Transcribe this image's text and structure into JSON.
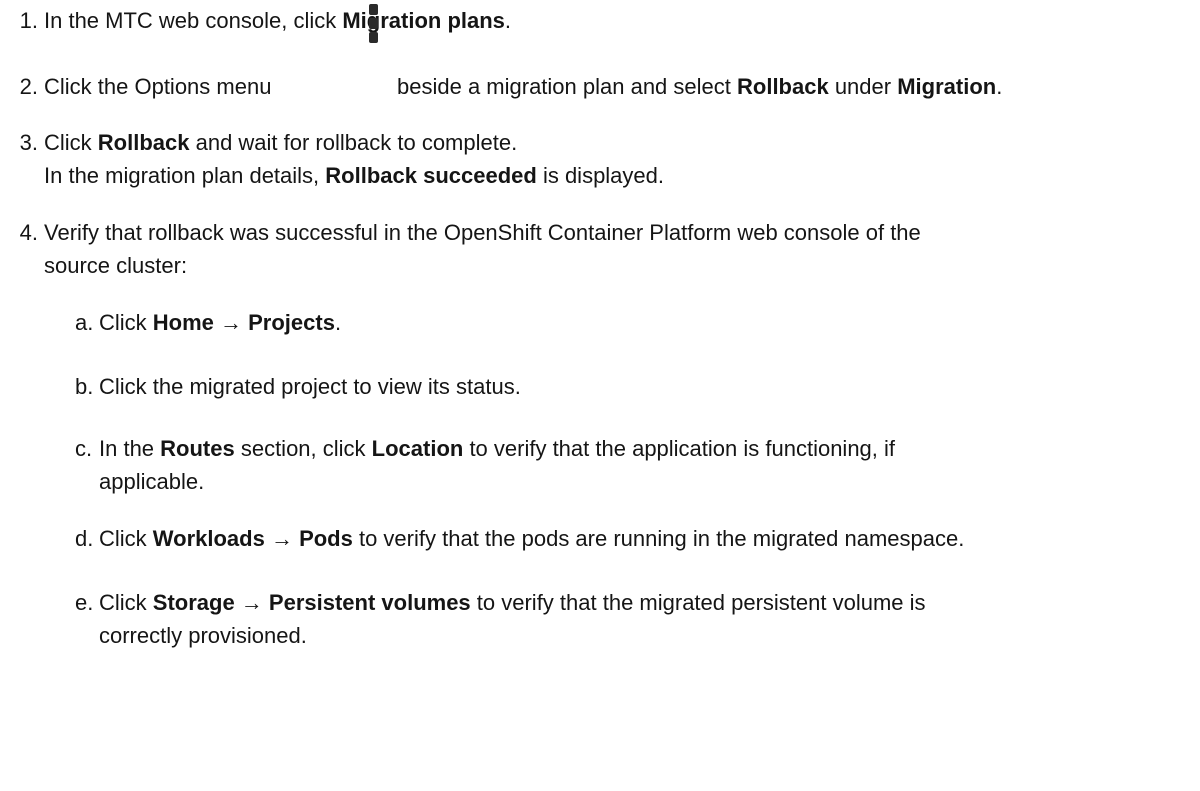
{
  "steps": [
    {
      "number": "1.",
      "parts": [
        "In the MTC web console, click ",
        "Migration plans",
        "."
      ]
    },
    {
      "number": "2.",
      "parts": [
        "Click the Options menu",
        "beside a migration plan and select ",
        "Rollback",
        " under ",
        "Migration",
        "."
      ],
      "icon": "kebab-icon"
    },
    {
      "number": "3.",
      "parts": [
        "Click ",
        "Rollback",
        " and wait for rollback to complete."
      ],
      "note_parts": [
        "In the migration plan details, ",
        "Rollback succeeded",
        " is displayed."
      ]
    },
    {
      "number": "4.",
      "lines": [
        "Verify that rollback was successful in the OpenShift Container Platform web console of the",
        "source cluster:"
      ],
      "substeps": [
        {
          "letter": "a.",
          "parts": [
            "Click ",
            "Home → Projects",
            "."
          ]
        },
        {
          "letter": "b.",
          "parts": [
            "Click the migrated project to view its status."
          ]
        },
        {
          "letter": "c.",
          "parts": [
            "In the ",
            "Routes",
            " section, click ",
            "Location",
            " to verify that the application is functioning, if"
          ],
          "continuation": "applicable."
        },
        {
          "letter": "d.",
          "parts": [
            "Click ",
            "Workloads → Pods",
            " to verify that the pods are running in the migrated namespace."
          ]
        },
        {
          "letter": "e.",
          "parts": [
            "Click ",
            "Storage → Persistent volumes",
            " to verify that the migrated persistent volume is"
          ],
          "continuation": "correctly provisioned."
        }
      ]
    }
  ]
}
